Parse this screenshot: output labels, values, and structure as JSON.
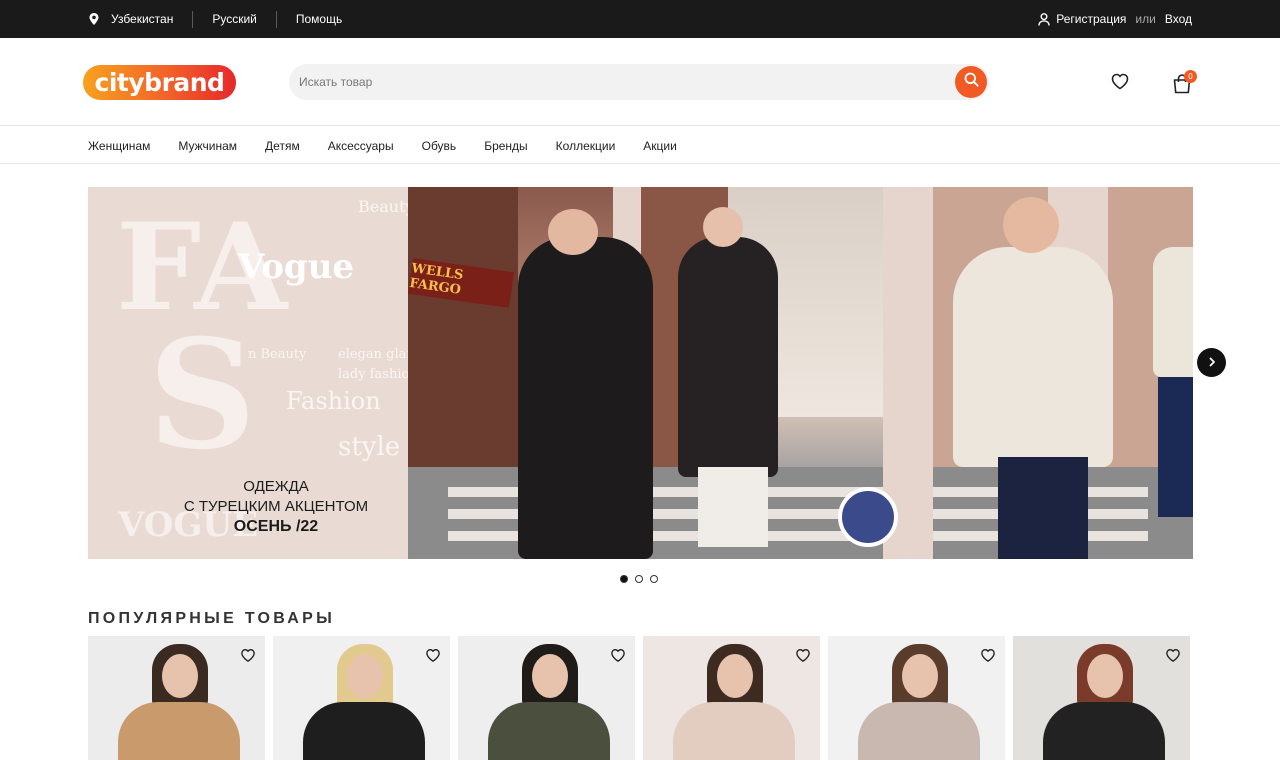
{
  "topbar": {
    "country": "Узбекистан",
    "language": "Русский",
    "help": "Помощь",
    "register": "Регистрация",
    "or": "или",
    "login": "Вход"
  },
  "header": {
    "logo": "citybrand",
    "search_placeholder": "Искать товар",
    "cart_count": "0"
  },
  "nav": {
    "items": [
      "Женщинам",
      "Мужчинам",
      "Детям",
      "Аксессуары",
      "Обувь",
      "Бренды",
      "Коллекции",
      "Акции"
    ]
  },
  "banner": {
    "line1": "ОДЕЖДА",
    "line2": "С ТУРЕЦКИМ АКЦЕНТОМ",
    "line3": "ОСЕНЬ /22",
    "sign": "WELLS FARGO",
    "collage_words": [
      "FA",
      "S",
      "Vogue",
      "Beauty",
      "Fashion",
      "style",
      "elegan glam",
      "lady fashion",
      "n Beauty",
      "VOGUE",
      "Fash",
      "st"
    ],
    "slides_total": 3,
    "active_slide": 1
  },
  "popular": {
    "title": "ПОПУЛЯРНЫЕ ТОВАРЫ",
    "items": [
      {
        "bg": "#ececec",
        "coat": "#c89a6c",
        "hair": "#3a2a22"
      },
      {
        "bg": "#f0f0f0",
        "coat": "#1e1e1e",
        "hair": "#e2c98e"
      },
      {
        "bg": "#eeeeee",
        "coat": "#4b4f3d",
        "hair": "#1f1b18"
      },
      {
        "bg": "#eee6e2",
        "coat": "#e2cdc0",
        "hair": "#3d2b22"
      },
      {
        "bg": "#f1f1f1",
        "coat": "#c9b8b0",
        "hair": "#5a3c2c"
      },
      {
        "bg": "#e2e0dc",
        "coat": "#222222",
        "hair": "#7a3b2a"
      }
    ]
  },
  "colors": {
    "accent": "#f15a24",
    "topbar_bg": "#1a1a1a"
  }
}
